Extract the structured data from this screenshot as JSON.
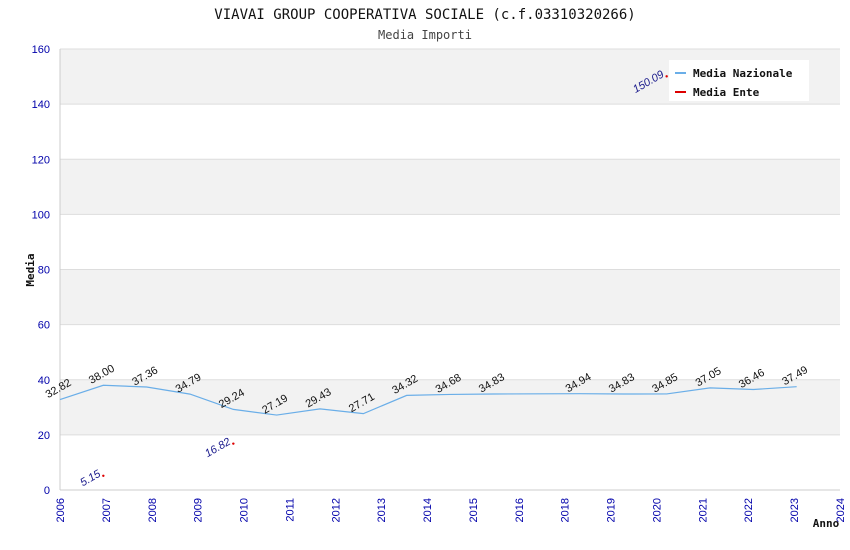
{
  "chart_data": {
    "type": "line",
    "title": "VIAVAI GROUP COOPERATIVA SOCIALE (c.f.03310320266)",
    "subtitle": "Media Importi",
    "xlabel": "Anno",
    "ylabel": "Media",
    "xlim": [
      2006,
      2024
    ],
    "ylim": [
      0,
      160
    ],
    "x_ticks": [
      "2006",
      "2007",
      "2008",
      "2009",
      "2010",
      "2011",
      "2012",
      "2013",
      "2014",
      "2015",
      "2016",
      "2018",
      "2019",
      "2020",
      "2021",
      "2022",
      "2023",
      "2024"
    ],
    "y_ticks": [
      "0",
      "20",
      "40",
      "60",
      "80",
      "100",
      "120",
      "140",
      "160"
    ],
    "grid": true,
    "legend_position": "top-right",
    "series": [
      {
        "name": "Media Nazionale",
        "color": "#6aaee8",
        "x": [
          "2006",
          "2007",
          "2008",
          "2009",
          "2010",
          "2011",
          "2012",
          "2013",
          "2014",
          "2015",
          "2016",
          "2018",
          "2019",
          "2020",
          "2021",
          "2022",
          "2023"
        ],
        "values": [
          32.82,
          38.0,
          37.36,
          34.79,
          29.24,
          27.19,
          29.43,
          27.71,
          34.32,
          34.68,
          34.83,
          34.94,
          34.83,
          34.85,
          37.05,
          36.46,
          37.49
        ],
        "labels": [
          "32.82",
          "38.00",
          "37.36",
          "34.79",
          "29.24",
          "27.19",
          "29.43",
          "27.71",
          "34.32",
          "34.68",
          "34.83",
          "34.94",
          "34.83",
          "34.85",
          "37.05",
          "36.46",
          "37.49"
        ]
      },
      {
        "name": "Media Ente",
        "color": "#dd0000",
        "x": [
          "2007",
          "2010",
          "2020"
        ],
        "values": [
          5.15,
          16.82,
          150.09
        ],
        "labels": [
          "5.15",
          "16.82",
          "150.09"
        ]
      }
    ]
  }
}
